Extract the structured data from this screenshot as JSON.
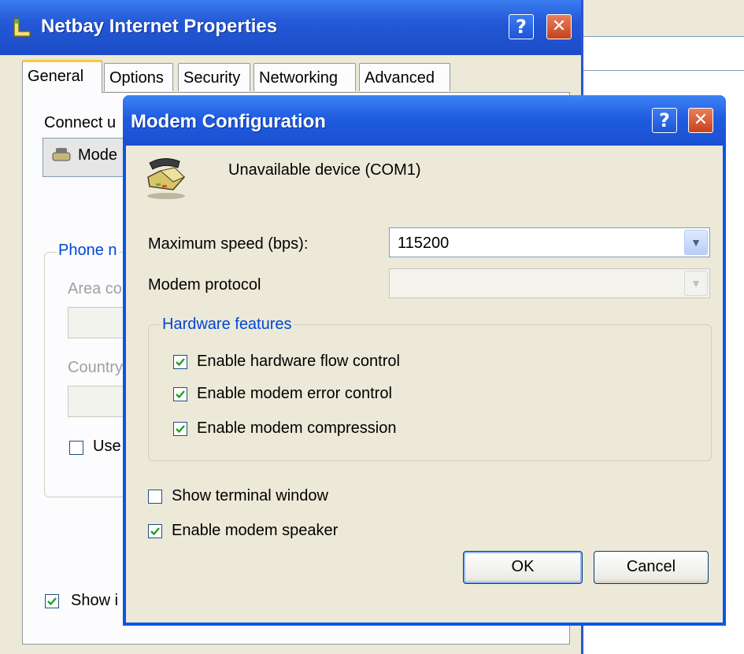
{
  "background_window": {},
  "back_window": {
    "title": "Netbay Internet Properties",
    "tabs": [
      {
        "label": "General",
        "active": true
      },
      {
        "label": "Options"
      },
      {
        "label": "Security"
      },
      {
        "label": "Networking"
      },
      {
        "label": "Advanced"
      }
    ],
    "connect_label": "Connect u",
    "modem_item": "Mode",
    "phone_group_label": "Phone n",
    "area_label": "Area co",
    "country_label": "Country",
    "use_label": "Use",
    "use_checked": false,
    "show_label": "Show i",
    "show_checked": true
  },
  "dialog": {
    "title": "Modem Configuration",
    "device": "Unavailable device (COM1)",
    "max_speed_label": "Maximum speed (bps):",
    "max_speed_value": "115200",
    "protocol_label": "Modem protocol",
    "protocol_value": "",
    "hardware_group_label": "Hardware features",
    "checkboxes": [
      {
        "label": "Enable hardware flow control",
        "checked": true
      },
      {
        "label": "Enable modem error control",
        "checked": true
      },
      {
        "label": "Enable modem compression",
        "checked": true
      },
      {
        "label": "Show terminal window",
        "checked": false
      },
      {
        "label": "Enable modem speaker",
        "checked": true
      }
    ],
    "ok_label": "OK",
    "cancel_label": "Cancel"
  },
  "title_buttons": {
    "help": "?",
    "close": "✕"
  }
}
